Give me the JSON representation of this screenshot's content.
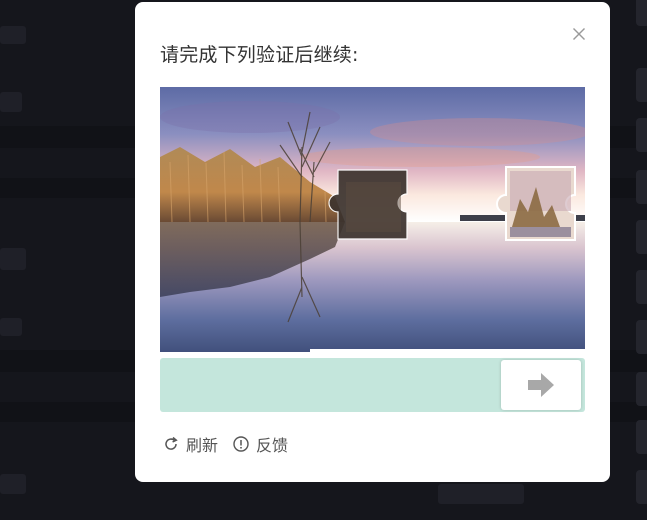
{
  "captcha_modal": {
    "title": "请完成下列验证后继续:",
    "close_icon": "close-icon",
    "refresh_label": "刷新",
    "refresh_icon": "refresh-icon",
    "feedback_label": "反馈",
    "feedback_icon": "info-circle-icon",
    "slider_icon": "arrow-right-icon",
    "slider_progress": 0,
    "colors": {
      "track": "#c4e6dc",
      "handle": "#ffffff",
      "arrow": "#a8a8a8",
      "text": "#333333"
    }
  }
}
